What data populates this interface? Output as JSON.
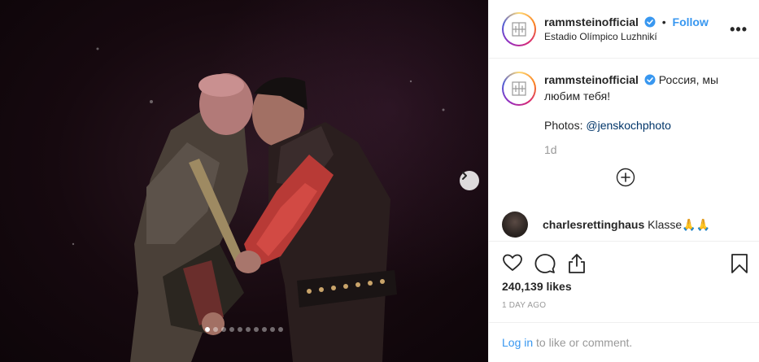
{
  "post": {
    "username": "rammsteinofficial",
    "follow_label": "Follow",
    "separator": "•",
    "location": "Estadio Olímpico Luzhnikí",
    "more_label": "•••"
  },
  "caption": {
    "username": "rammsteinofficial",
    "text_line": "Россия, мы любим тебя!",
    "photos_prefix": "Photos: ",
    "mention": "@jenskochphoto",
    "time": "1d"
  },
  "comment": {
    "username": "charlesrettinghaus",
    "text": "Klasse🙏🙏"
  },
  "stats": {
    "likes": "240,139 likes",
    "age": "1 DAY AGO"
  },
  "login": {
    "link": "Log in",
    "rest": " to like or comment."
  },
  "carousel": {
    "slide_count": 10,
    "active_index": 0
  },
  "colors": {
    "accent": "#3897f0",
    "verified": "#3897f0",
    "border": "#efefef"
  },
  "icons": [
    "verified-badge-icon",
    "rammstein-logo-icon",
    "chevron-right-icon",
    "add-circle-icon",
    "heart-icon",
    "comment-icon",
    "share-icon",
    "bookmark-icon",
    "more-icon"
  ]
}
